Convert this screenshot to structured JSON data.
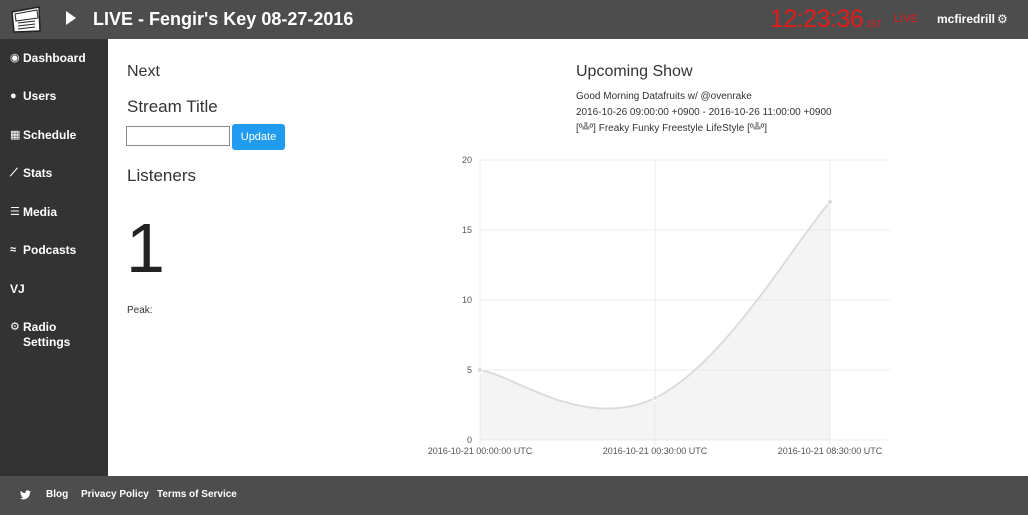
{
  "topbar": {
    "now_playing": "LIVE - Fengir's Key 08-27-2016",
    "clock": "12:23:36",
    "timezone": "JST",
    "live_label": "LIVE",
    "username": "mcfiredrill",
    "clock_color": "#e21b1b"
  },
  "sidebar": {
    "items": [
      {
        "icon": "dashboard-icon",
        "label": "Dashboard"
      },
      {
        "icon": "users-icon",
        "label": "Users"
      },
      {
        "icon": "calendar-icon",
        "label": "Schedule"
      },
      {
        "icon": "line-chart-icon",
        "label": "Stats"
      },
      {
        "icon": "list-icon",
        "label": "Media"
      },
      {
        "icon": "rss-icon",
        "label": "Podcasts"
      },
      {
        "icon": "",
        "label": "VJ"
      },
      {
        "icon": "gear-icon",
        "label": "Radio Settings"
      }
    ]
  },
  "main": {
    "next_heading": "Next",
    "stream_title_heading": "Stream Title",
    "stream_title_value": "",
    "update_label": "Update",
    "listeners_heading": "Listeners",
    "listener_count": "1",
    "peak_label": "Peak:",
    "accent_color": "#1f9cf0"
  },
  "upcoming": {
    "heading": "Upcoming Show",
    "name": "Good Morning Datafruits w/ @ovenrake",
    "time": "2016-10-26 09:00:00 +0900 - 2016-10-26 11:00:00 +0900",
    "description": "[º╩º] Freaky Funky Freestyle LifeStyle [º╩º]"
  },
  "chart_data": {
    "type": "area",
    "x": [
      "2016-10-21 00:00:00 UTC",
      "2016-10-21 00:30:00 UTC",
      "2016-10-21 08:30:00 UTC"
    ],
    "series": [
      {
        "values": [
          5,
          3,
          17
        ]
      }
    ],
    "ylim": [
      0,
      20
    ],
    "yticks": [
      0,
      5,
      10,
      15,
      20
    ],
    "grid": true
  },
  "footer": {
    "twitter_icon": "twitter-icon",
    "blog": "Blog",
    "privacy": "Privacy Policy",
    "terms": "Terms of Service"
  }
}
